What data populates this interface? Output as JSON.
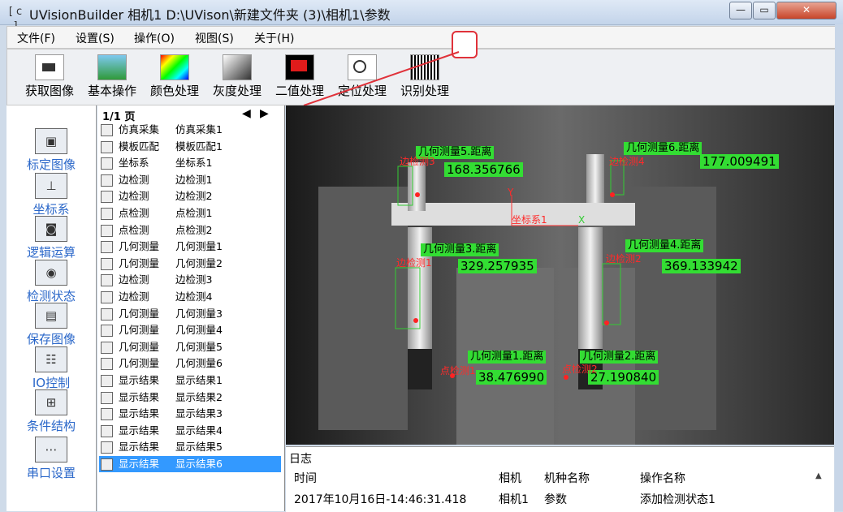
{
  "window": {
    "icon": "[ c ]",
    "title": "UVisionBuilder   相机1 D:\\UVison\\新建文件夹 (3)\\相机1\\参数",
    "minimize": "—",
    "maximize": "▭",
    "close": "✕"
  },
  "menu": [
    "文件(F)",
    "设置(S)",
    "操作(O)",
    "视图(S)",
    "关于(H)"
  ],
  "toolbar": [
    {
      "label": "获取图像",
      "icon": "camera-icon"
    },
    {
      "label": "基本操作",
      "icon": "image-icon"
    },
    {
      "label": "颜色处理",
      "icon": "color-gradient-icon"
    },
    {
      "label": "灰度处理",
      "icon": "grayscale-icon"
    },
    {
      "label": "二值处理",
      "icon": "binary-icon"
    },
    {
      "label": "定位处理",
      "icon": "locate-icon"
    },
    {
      "label": "识别处理",
      "icon": "barcode-icon"
    }
  ],
  "nav": [
    {
      "label": "标定图像",
      "icon": "calibrate-icon"
    },
    {
      "label": "坐标系",
      "icon": "axis-icon"
    },
    {
      "label": "逻辑运算",
      "icon": "logic-icon"
    },
    {
      "label": "检测状态",
      "icon": "status-icon"
    },
    {
      "label": "保存图像",
      "icon": "save-image-icon"
    },
    {
      "label": "IO控制",
      "icon": "io-icon"
    },
    {
      "label": "条件结构",
      "icon": "condition-icon"
    },
    {
      "label": "串口设置",
      "icon": "serial-icon"
    }
  ],
  "pager": {
    "info": "1/1 页",
    "prev": "◀",
    "next": "▶"
  },
  "steps": [
    {
      "type": "仿真采集",
      "name": "仿真采集1"
    },
    {
      "type": "模板匹配",
      "name": "模板匹配1"
    },
    {
      "type": "坐标系",
      "name": "坐标系1"
    },
    {
      "type": "边检测",
      "name": "边检测1"
    },
    {
      "type": "边检测",
      "name": "边检测2"
    },
    {
      "type": "点检测",
      "name": "点检测1"
    },
    {
      "type": "点检测",
      "name": "点检测2"
    },
    {
      "type": "几何测量",
      "name": "几何测量1"
    },
    {
      "type": "几何测量",
      "name": "几何测量2"
    },
    {
      "type": "边检测",
      "name": "边检测3"
    },
    {
      "type": "边检测",
      "name": "边检测4"
    },
    {
      "type": "几何测量",
      "name": "几何测量3"
    },
    {
      "type": "几何测量",
      "name": "几何测量4"
    },
    {
      "type": "几何测量",
      "name": "几何测量5"
    },
    {
      "type": "几何测量",
      "name": "几何测量6"
    },
    {
      "type": "显示结果",
      "name": "显示结果1"
    },
    {
      "type": "显示结果",
      "name": "显示结果2"
    },
    {
      "type": "显示结果",
      "name": "显示结果3"
    },
    {
      "type": "显示结果",
      "name": "显示结果4"
    },
    {
      "type": "显示结果",
      "name": "显示结果5"
    },
    {
      "type": "显示结果",
      "name": "显示结果6"
    }
  ],
  "selected_step": 20,
  "overlay": {
    "m5_label": "几何测量5.距离",
    "m5_value": "168.356766",
    "m6_label": "几何测量6.距离",
    "m6_value": "177.009491",
    "m3_label": "几何测量3.距离",
    "m3_value": "329.257935",
    "m4_label": "几何测量4.距离",
    "m4_value": "369.133942",
    "m1_label": "几何测量1.距离",
    "m1_value": "38.476990",
    "m2_label": "几何测量2.距离",
    "m2_value": "27.190840",
    "edge3": "边检测3",
    "edge4": "边检测4",
    "edge1": "边检测1",
    "edge2": "边检测2",
    "pt1": "点检测1",
    "pt2": "点检测2",
    "coord": "坐标系1",
    "axis_y": "Y",
    "axis_x": "X"
  },
  "log": {
    "title": "日志",
    "headers": [
      "时间",
      "相机",
      "机种名称",
      "操作名称"
    ],
    "rows": [
      [
        "2017年10月16日-14:46:31.418",
        "相机1",
        "参数",
        "添加检测状态1"
      ]
    ],
    "scroll_up": "▲"
  }
}
